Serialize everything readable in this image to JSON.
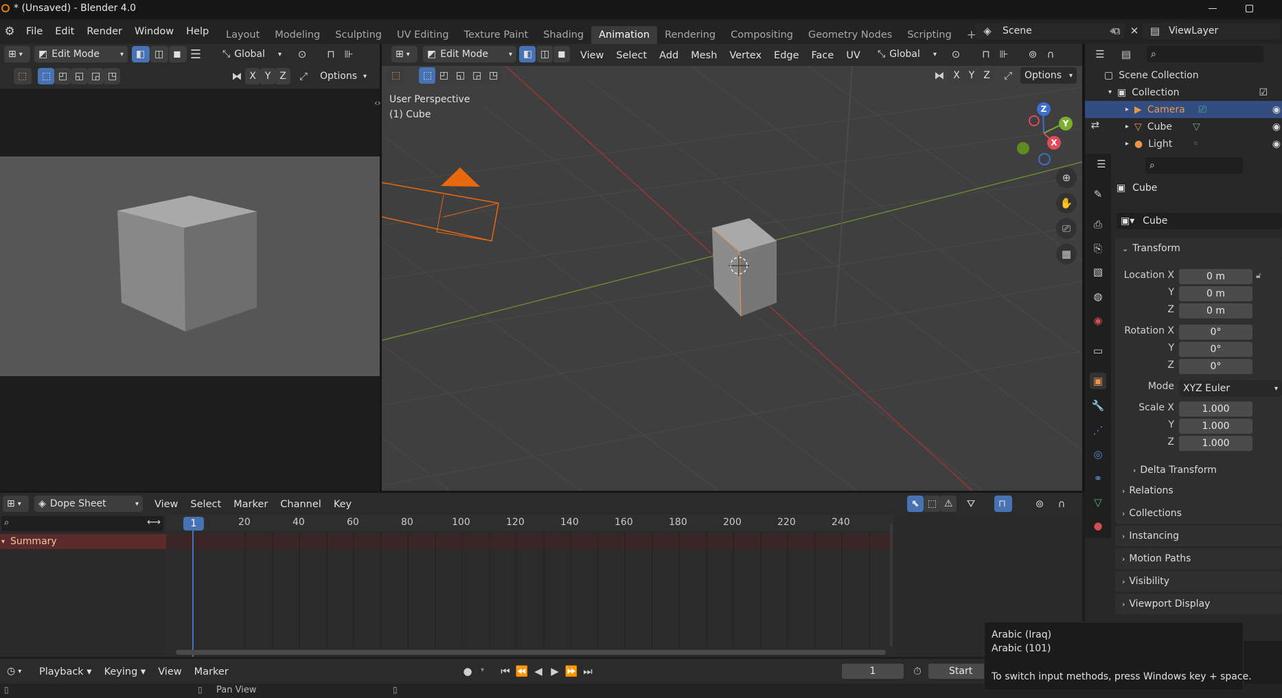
{
  "title": "* (Unsaved) - Blender 4.0",
  "menu": [
    "File",
    "Edit",
    "Render",
    "Window",
    "Help"
  ],
  "workspaces": [
    "Layout",
    "Modeling",
    "Sculpting",
    "UV Editing",
    "Texture Paint",
    "Shading",
    "Animation",
    "Rendering",
    "Compositing",
    "Geometry Nodes",
    "Scripting"
  ],
  "active_workspace": "Animation",
  "scene": "Scene",
  "view_layer": "ViewLayer",
  "left_editor": {
    "mode": "Edit Mode",
    "orientation": "Global",
    "axes": [
      "X",
      "Y",
      "Z"
    ],
    "options": "Options"
  },
  "viewport": {
    "mode": "Edit Mode",
    "menus": [
      "View",
      "Select",
      "Add",
      "Mesh",
      "Vertex",
      "Edge",
      "Face",
      "UV"
    ],
    "orientation": "Global",
    "axes": [
      "X",
      "Y",
      "Z"
    ],
    "options": "Options",
    "overlay_line1": "User Perspective",
    "overlay_line2": "(1) Cube",
    "gizmo": {
      "z": "Z",
      "y": "Y",
      "x": "X"
    }
  },
  "outliner": {
    "root": "Scene Collection",
    "collection": "Collection",
    "items": [
      {
        "name": "Camera",
        "selected": true,
        "color": "#e8964b"
      },
      {
        "name": "Cube",
        "selected": false,
        "color": "#d6d6d6"
      },
      {
        "name": "Light",
        "selected": false,
        "color": "#d6d6d6"
      }
    ]
  },
  "properties": {
    "object_name": "Cube",
    "data_name": "Cube",
    "transform_label": "Transform",
    "location": {
      "label": "Location X",
      "x": "0 m",
      "y": "0 m",
      "z": "0 m"
    },
    "rotation": {
      "label": "Rotation X",
      "x": "0°",
      "y": "0°",
      "z": "0°"
    },
    "mode_label": "Mode",
    "mode_value": "XYZ Euler",
    "scale": {
      "label": "Scale X",
      "x": "1.000",
      "y": "1.000",
      "z": "1.000"
    },
    "axis_y": "Y",
    "axis_z": "Z",
    "delta": "Delta Transform",
    "sections": [
      "Relations",
      "Collections",
      "Instancing",
      "Motion Paths",
      "Visibility",
      "Viewport Display"
    ]
  },
  "dopesheet": {
    "mode": "Dope Sheet",
    "menus": [
      "View",
      "Select",
      "Marker",
      "Channel",
      "Key"
    ],
    "current_frame": "1",
    "ruler": [
      "20",
      "40",
      "60",
      "80",
      "100",
      "120",
      "140",
      "160",
      "180",
      "200",
      "220",
      "240"
    ],
    "summary": "Summary"
  },
  "timeline": {
    "menus": [
      "Playback",
      "Keying",
      "View",
      "Marker"
    ],
    "frame": "1",
    "start_label": "Start"
  },
  "status": {
    "pan": "Pan View"
  },
  "ime_tooltip": {
    "line1": "Arabic (Iraq)",
    "line2": "Arabic (101)",
    "line3": "To switch input methods, press Windows key + space."
  }
}
